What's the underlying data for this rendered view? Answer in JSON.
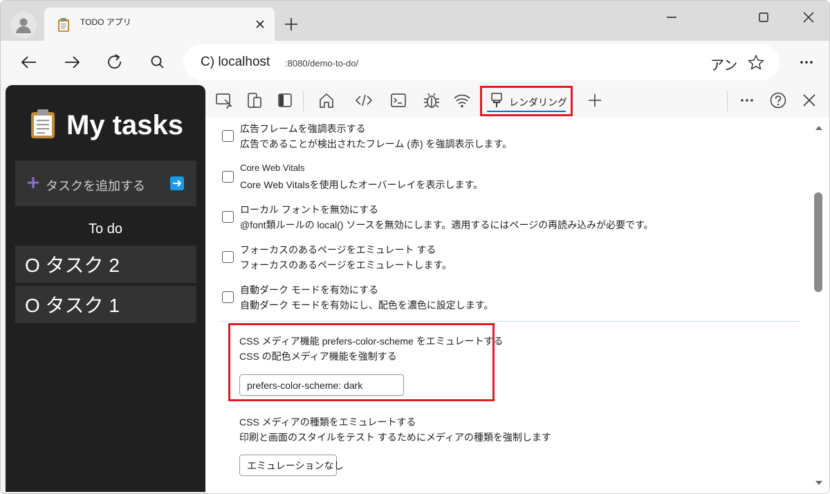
{
  "browser": {
    "tab_title": "TODO アプリ",
    "tab_subtitle": "· · · · · · ·",
    "address": {
      "scheme": "C) localhost",
      "path": ":8080/demo-to-do/",
      "language": "アン"
    }
  },
  "app": {
    "title": "My tasks",
    "add_task_label": "タスクを追加する",
    "todo_heading": "To do",
    "tasks": [
      "O タスク 2",
      "O タスク 1"
    ]
  },
  "devtools": {
    "active_tab_label": "レンダリング",
    "options": [
      {
        "title": "広告フレームを強調表示する",
        "desc": "広告であることが検出されたフレーム (赤) を強調表示します。"
      },
      {
        "title": "Core Web Vitals",
        "desc": "Core Web Vitalsを使用したオーバーレイを表示します。"
      },
      {
        "title": "ローカル フォントを無効にする",
        "desc": "@font類ルールの local() ソースを無効にします。適用するにはページの再読み込みが必要です。"
      },
      {
        "title": "フォーカスのあるページをエミュレート する",
        "desc": "フォーカスのあるページをエミュレートします。"
      },
      {
        "title": "自動ダーク モードを有効にする",
        "desc": "自動ダーク モードを有効にし、配色を濃色に設定します。"
      }
    ],
    "color_scheme": {
      "title": "CSS メディア機能 prefers-color-scheme をエミュレートする",
      "desc": "CSS の配色メディア機能を強制する",
      "value": "prefers-color-scheme: dark"
    },
    "media_type": {
      "title": "CSS メディアの種類をエミュレートする",
      "desc": "印刷と画面のスタイルをテスト するためにメディアの種類を強制します",
      "value": "エミュレーションなし"
    }
  },
  "colors": {
    "highlight": "#e31b23",
    "app_bg": "#202020",
    "accent": "#0f6cbd"
  }
}
